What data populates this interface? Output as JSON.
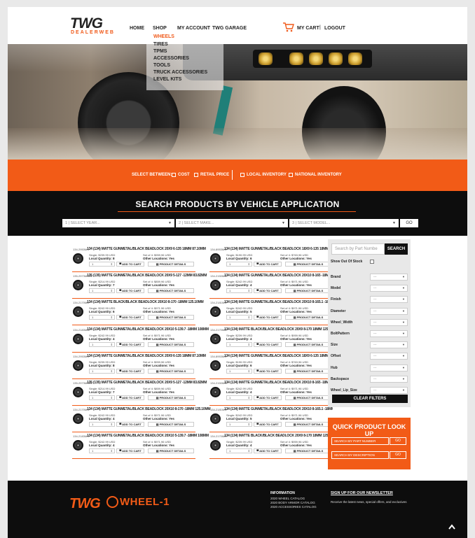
{
  "header": {
    "logo_main": "TWG",
    "logo_sub": "DEALERWEB",
    "nav": [
      "HOME",
      "SHOP",
      "MY ACCOUNT",
      "TWG GARAGE"
    ],
    "cart": "MY CART",
    "separator": "|",
    "logout": "LOGOUT"
  },
  "shop_menu": {
    "items": [
      "WHEELS",
      "TIRES",
      "TPMS",
      "ACCESSORIES",
      "TOOLS",
      "TRUCK ACCESSORIES",
      "LEVEL KITS"
    ],
    "active": "WHEELS"
  },
  "filter_band": {
    "select_between": "SELECT BETWEEN:",
    "options": [
      "COST",
      "RETAIL PRICE",
      "LOCAL INVENTORY",
      "NATIONAL INVENTORY"
    ]
  },
  "vehicle_search": {
    "title": "SEARCH PRODUCTS BY VEHICLE APPLICATION",
    "year": "1 | SELECT YEAR...",
    "make": "2 | SELECT MAKE...",
    "model": "3 | SELECT MODEL...",
    "go": "GO"
  },
  "product_buttons": {
    "add_to_cart": "ADD TO CART",
    "details": "PRODUCT DETAILS",
    "qty": "1"
  },
  "products": [
    {
      "sku": "134-2953MG",
      "name": "134 (134) MATTE GUNMETAL/BLACK BEADLOCK 20X9 6-135 18MM 87.10MM",
      "single": "Single: $239.99 USD",
      "lq": "Local Quantity: 8",
      "set": "Set of 4: $959.96 USD",
      "ol": "Other Locations: Yes"
    },
    {
      "sku": "134-8953MG",
      "name": "134 (134) MATTE GUNMETAL/BLACK BEADLOCK 18X9 6-135 18MM 87.10MM",
      "single": "Single: $190.99 USD",
      "lq": "Local Quantity: 6",
      "set": "Set of 4: $763.96 USD",
      "ol": "Other Locations: Yes"
    },
    {
      "sku": "135-2973MG12",
      "name": "135 (135) MATTE GUNMETAL/BLACK BEADLOCK 20X9 5-127 -12MM 83.82MM",
      "single": "Single: $214.99 USD",
      "lq": "Local Quantity: 7",
      "set": "Set of 4: $859.96 USD",
      "ol": "Other Locations: Yes"
    },
    {
      "sku": "134-2150MG",
      "name": "134 (134) MATTE GUNMETAL/BLACK BEADLOCK 20X10 8-165 -18MM 125.10MM",
      "single": "Single: $242.99 USD",
      "lq": "Local Quantity: 4",
      "set": "Set of 4: $971.96 USD",
      "ol": "Other Locations: Yes"
    },
    {
      "sku": "134-2170MB",
      "name": "134 (134) MATTE BLACK/BLACK BEADLOCK 20X10 8-170 -18MM 125.10MM",
      "single": "Single: $242.99 USD",
      "lq": "Local Quantity: 6",
      "set": "Set of 4: $971.96 USD",
      "ol": "Other Locations: Yes"
    },
    {
      "sku": "134-2181MG",
      "name": "134 (134) MATTE GUNMETAL/BLACK BEADLOCK 20X10 8-165.1 -18MM 125.10MM",
      "single": "Single: $242.99 USD",
      "lq": "Local Quantity: 5",
      "set": "Set of 4: $971.96 USD",
      "ol": "Other Locations: Yes"
    },
    {
      "sku": "134-2183MG",
      "name": "134 (134) MATTE GUNMETAL/BLACK BEADLOCK 20X10 5-139.7 -18MM 108MM",
      "single": "Single: $242.99 USD",
      "lq": "Local Quantity: 4",
      "set": "Set of 4: $971.96 USD",
      "ol": "Other Locations: Yes"
    },
    {
      "sku": "134-2170MB",
      "name": "134 (134) MATTE BLACK/BLACK BEADLOCK 20X9 8-170 18MM 125.10MM",
      "single": "Single: $239.99 USD",
      "lq": "Local Quantity: 4",
      "set": "Set of 4: $959.96 USD",
      "ol": "Other Locations: Yes"
    },
    {
      "sku": "134-2953MG",
      "name": "134 (134) MATTE GUNMETAL/BLACK BEADLOCK 20X9 6-135 18MM 87.10MM",
      "single": "Single: $239.99 USD",
      "lq": "Local Quantity: 8",
      "set": "Set of 4: $959.96 USD",
      "ol": "Other Locations: Yes"
    },
    {
      "sku": "134-8953MG",
      "name": "134 (134) MATTE GUNMETAL/BLACK BEADLOCK 18X9 6-135 18MM 87.10MM",
      "single": "Single: $190.99 USD",
      "lq": "Local Quantity: 6",
      "set": "Set of 4: $763.96 USD",
      "ol": "Other Locations: Yes"
    },
    {
      "sku": "135-2973MG12",
      "name": "135 (135) MATTE GUNMETAL/BLACK BEADLOCK 20X9 5-127 -12MM 83.82MM",
      "single": "Single: $214.99 USD",
      "lq": "Local Quantity: 7",
      "set": "Set of 4: $859.96 USD",
      "ol": "Other Locations: Yes"
    },
    {
      "sku": "134-2150MG",
      "name": "134 (134) MATTE GUNMETAL/BLACK BEADLOCK 20X10 8-165 -18MM 125.10MM",
      "single": "Single: $242.99 USD",
      "lq": "Local Quantity: 4",
      "set": "Set of 4: $971.96 USD",
      "ol": "Other Locations: Yes"
    },
    {
      "sku": "134-2170MG",
      "name": "134 (134) MATTE GUNMETAL/BLACK BEADLOCK 20X10 8-170 -18MM 125.10MM",
      "single": "Single: $242.99 USD",
      "lq": "Local Quantity: 4",
      "set": "Set of 4: $971.96 USD",
      "ol": "Other Locations: Yes"
    },
    {
      "sku": "134-2181MG",
      "name": "134 (134) MATTE GUNMETAL/BLACK BEADLOCK 20X10 8-165.1 -18MM 125.10MM",
      "single": "Single: $242.99 USD",
      "lq": "Local Quantity: 5",
      "set": "Set of 4: $971.96 USD",
      "ol": "Other Locations: Yes"
    },
    {
      "sku": "134-2183MG",
      "name": "134 (134) MATTE GUNMETAL/BLACK BEADLOCK 20X10 5-139.7 -18MM 108MM",
      "single": "Single: $242.99 USD",
      "lq": "Local Quantity: 4",
      "set": "Set of 4: $971.96 USD",
      "ol": "Other Locations: Yes"
    },
    {
      "sku": "134-2170MB",
      "name": "134 (134) MATTE BLACK/BLACK BEADLOCK 20X9 8-170 18MM 125.10MM",
      "single": "Single: $239.99 USD",
      "lq": "Local Quantity: 4",
      "set": "Set of 4: $959.96 USD",
      "ol": "Other Locations: Yes"
    }
  ],
  "filters": {
    "search_placeholder": "Search by Part Numbe",
    "search_button": "SEARCH",
    "out_of_stock": "Show Out Of Stock",
    "select_value": "---",
    "labels": [
      "Brand",
      "Model",
      "Finish",
      "Diameter",
      "Wheel_Width",
      "BoltPattern",
      "Size",
      "Offset",
      "Hub",
      "Backspace",
      "Wheel_Lip_Size"
    ],
    "clear": "CLEAR FILTERS"
  },
  "quick_lookup": {
    "title": "QUICK PRODUCT LOOK UP",
    "part_placeholder": "SEARCH BY PART NUMBER",
    "desc_placeholder": "SEARCH BY DESCRIPTION",
    "go": "GO"
  },
  "footer": {
    "logo1": "TWG",
    "logo2": "WHEEL-1",
    "info_title": "INFORMATION",
    "info_links": [
      "2020 WHEEL CATALOG",
      "2020 BODY ARMOR CATALOG",
      "2020 ACCESSORIES CATALOG"
    ],
    "newsletter_title": "SIGN UP FOR OUR NEWSLETTER",
    "newsletter_text": "Receive the latest news, special offers, and exclusives"
  },
  "colors": {
    "accent": "#f25b17",
    "dark": "#0d0d0d",
    "panel": "#e8e8e8"
  },
  "icons": [
    "cart-icon",
    "chevron-up-icon",
    "wheel-thumbnail-icon"
  ]
}
